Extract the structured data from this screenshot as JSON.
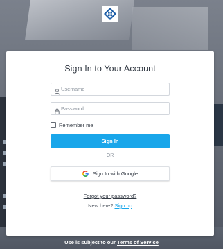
{
  "login": {
    "title": "Sign In to Your Account",
    "username_placeholder": "Username",
    "password_placeholder": "Password",
    "remember_label": "Remember me",
    "remember_checked": false,
    "signin_label": "Sign In",
    "or_label": "OR",
    "google_label": "Sign In with Google",
    "forgot_label": "Forgot your password?",
    "new_here_label": "New here?",
    "signup_label": "Sign up"
  },
  "footer": {
    "text": "Use is subject to our",
    "terms_label": "Terms of Service"
  },
  "icons": {
    "username_icon": "user-icon",
    "password_icon": "lock-icon",
    "google_icon": "google-icon",
    "logo": "company-logo"
  },
  "colors": {
    "accent": "#19a6ea",
    "card_bg": "#ffffff",
    "logo_blue": "#1f5fa8"
  }
}
